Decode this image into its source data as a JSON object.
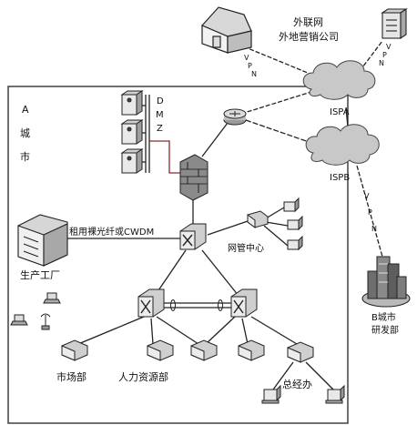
{
  "labels": {
    "remote_office_line1": "外联网",
    "remote_office_line2": "外地营销公司",
    "city_a": [
      "A",
      "城",
      "市"
    ],
    "dmz": [
      "D",
      "M",
      "Z"
    ],
    "isp_a": "ISPA",
    "isp_b": "ISPB",
    "vpn_left": [
      "V",
      "P",
      "N"
    ],
    "vpn_right": [
      "V",
      "P",
      "N"
    ],
    "vpn_isp": [
      "V",
      "P",
      "N"
    ],
    "fiber_link": "租用裸光纤或CWDM",
    "noc": "网管中心",
    "factory": "生产工厂",
    "city_b_line1": "B城市",
    "city_b_line2": "研发部",
    "marketing": "市场部",
    "hr": "人力资源部",
    "general_office": "总经办"
  }
}
